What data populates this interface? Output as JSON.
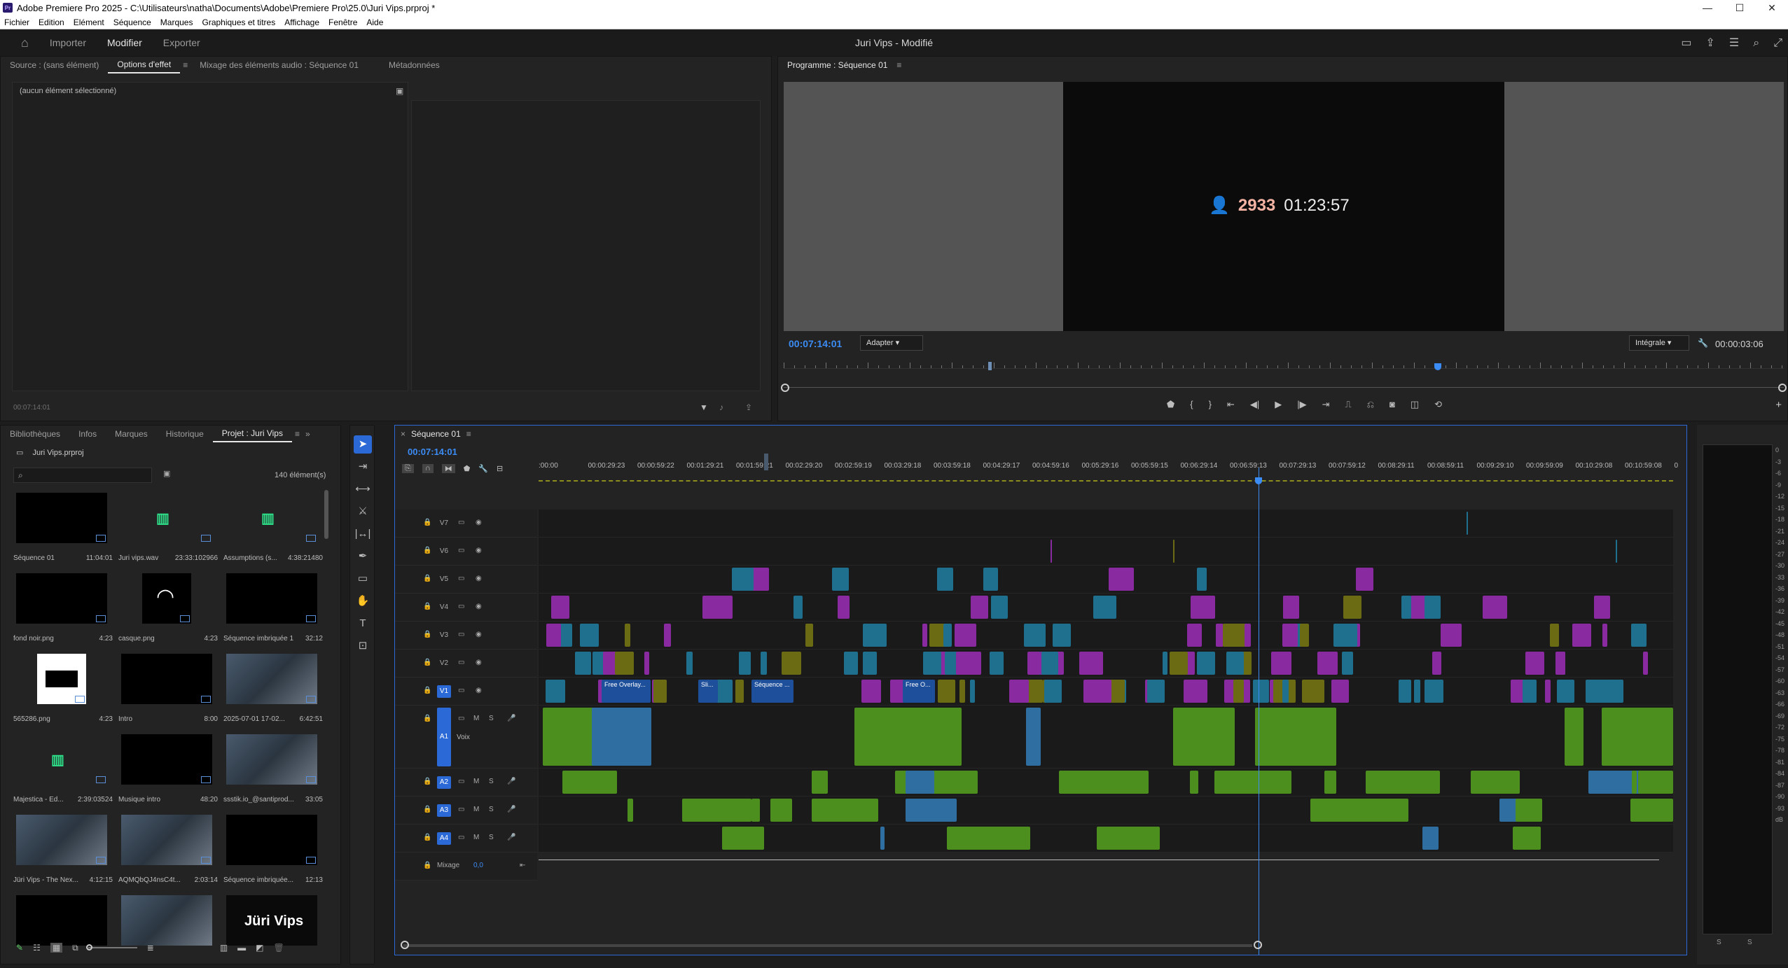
{
  "titlebar": {
    "text": "Adobe Premiere Pro 2025 - C:\\Utilisateurs\\natha\\Documents\\Adobe\\Premiere Pro\\25.0\\Juri Vips.prproj *",
    "icon": "Pr"
  },
  "menu": [
    "Fichier",
    "Edition",
    "Elément",
    "Séquence",
    "Marques",
    "Graphiques et titres",
    "Affichage",
    "Fenêtre",
    "Aide"
  ],
  "workspaces": {
    "home_icon": "home-icon",
    "items": [
      "Importer",
      "Modifier",
      "Exporter"
    ],
    "active": "Modifier",
    "title": "Juri Vips - Modifié"
  },
  "effect_panel": {
    "tabs": [
      "Source : (sans élément)",
      "Options d'effet",
      "Mixage des éléments audio : Séquence 01",
      "Métadonnées"
    ],
    "active_tab": "Options d'effet",
    "no_selection": "(aucun élément sélectionné)",
    "timecode": "00:07:14:01"
  },
  "program": {
    "tab": "Programme : Séquence 01",
    "overlay_count": "2933",
    "overlay_time": "01:23:57",
    "timecode": "00:07:14:01",
    "fit": "Adapter",
    "quality": "Intégrale",
    "duration": "00:00:03:06"
  },
  "project": {
    "tabs": [
      "Bibliothèques",
      "Infos",
      "Marques",
      "Historique",
      "Projet : Juri Vips"
    ],
    "active_tab": "Projet : Juri Vips",
    "file": "Juri Vips.prproj",
    "count": "140 élément(s)",
    "items": [
      {
        "name": "Séquence 01",
        "dur": "11:04:01"
      },
      {
        "name": "Juri vips.wav",
        "dur": "23:33:102966"
      },
      {
        "name": "Assumptions (s...",
        "dur": "4:38:21480"
      },
      {
        "name": "fond noir.png",
        "dur": "4:23"
      },
      {
        "name": "casque.png",
        "dur": "4:23"
      },
      {
        "name": "Séquence imbriquée 1",
        "dur": "32:12"
      },
      {
        "name": "565286.png",
        "dur": "4:23"
      },
      {
        "name": "Intro",
        "dur": "8:00"
      },
      {
        "name": "2025-07-01 17-02...",
        "dur": "6:42:51"
      },
      {
        "name": "Majestica - Ed...",
        "dur": "2:39:03524"
      },
      {
        "name": "Musique intro",
        "dur": "48:20"
      },
      {
        "name": "ssstik.io_@santiprod...",
        "dur": "33:05"
      },
      {
        "name": "Jüri Vips - The Nex...",
        "dur": "4:12:15"
      },
      {
        "name": "AQMQbQJ4nsC4t...",
        "dur": "2:03:14"
      },
      {
        "name": "Séquence imbriquée...",
        "dur": "12:13"
      },
      {
        "name": "",
        "dur": ""
      },
      {
        "name": "",
        "dur": ""
      },
      {
        "name": "",
        "dur": ""
      }
    ],
    "last_thumb_text": "Jüri Vips"
  },
  "timeline": {
    "tab": "Séquence 01",
    "timecode": "00:07:14:01",
    "ruler": [
      ":00:00",
      "00:00:29:23",
      "00:00:59:22",
      "00:01:29:21",
      "00:01:59:21",
      "00:02:29:20",
      "00:02:59:19",
      "00:03:29:18",
      "00:03:59:18",
      "00:04:29:17",
      "00:04:59:16",
      "00:05:29:16",
      "00:05:59:15",
      "00:06:29:14",
      "00:06:59:13",
      "00:07:29:13",
      "00:07:59:12",
      "00:08:29:11",
      "00:08:59:11",
      "00:09:29:10",
      "00:09:59:09",
      "00:10:29:08",
      "00:10:59:08",
      "0"
    ],
    "video_tracks": [
      "V7",
      "V6",
      "V5",
      "V4",
      "V3",
      "V2",
      "V1"
    ],
    "audio_tracks": [
      "A1",
      "A2",
      "A3",
      "A4"
    ],
    "a1_label": "Voix",
    "mix_label": "Mixage",
    "mix_value": "0,0",
    "clip_labels": [
      "Free Overlay...",
      "Sli...",
      "Séquence ...",
      "Free O..."
    ]
  },
  "meters": {
    "scale": [
      "0",
      "-3",
      "-6",
      "-9",
      "-12",
      "-15",
      "-18",
      "-21",
      "-24",
      "-27",
      "-30",
      "-33",
      "-36",
      "-39",
      "-42",
      "-45",
      "-48",
      "-51",
      "-54",
      "-57",
      "-60",
      "-63",
      "-66",
      "-69",
      "-72",
      "-75",
      "-78",
      "-81",
      "-84",
      "-87",
      "-90",
      "-93",
      "dB"
    ],
    "solo": [
      "S",
      "S"
    ]
  },
  "colors": {
    "accent": "#2b69d6",
    "timecode": "#3b8cf5",
    "video_clip": "#1f6f8f",
    "graphic_clip": "#8a2aa0",
    "adjust_clip": "#6b6b14",
    "audio_clip": "#4c8f1f"
  }
}
